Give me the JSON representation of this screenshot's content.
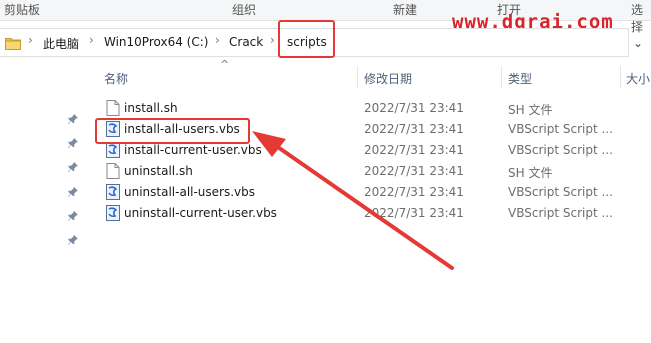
{
  "ribbon": {
    "groups": [
      "剪贴板",
      "组织",
      "新建",
      "打开",
      "选择"
    ]
  },
  "watermark": "www.dgrai.com",
  "address": {
    "crumbs": [
      "此电脑",
      "Win10Prox64 (C:)",
      "Crack",
      "scripts"
    ]
  },
  "columns": {
    "name": "名称",
    "date": "修改日期",
    "type": "类型",
    "size": "大小"
  },
  "files": [
    {
      "name": "install.sh",
      "date": "2022/7/31 23:41",
      "type": "SH 文件",
      "icon": "sh-file-icon"
    },
    {
      "name": "install-all-users.vbs",
      "date": "2022/7/31 23:41",
      "type": "VBScript Script ...",
      "icon": "vbs-file-icon"
    },
    {
      "name": "install-current-user.vbs",
      "date": "2022/7/31 23:41",
      "type": "VBScript Script ...",
      "icon": "vbs-file-icon"
    },
    {
      "name": "uninstall.sh",
      "date": "2022/7/31 23:41",
      "type": "SH 文件",
      "icon": "sh-file-icon"
    },
    {
      "name": "uninstall-all-users.vbs",
      "date": "2022/7/31 23:41",
      "type": "VBScript Script ...",
      "icon": "vbs-file-icon"
    },
    {
      "name": "uninstall-current-user.vbs",
      "date": "2022/7/31 23:41",
      "type": "VBScript Script ...",
      "icon": "vbs-file-icon"
    }
  ],
  "colors": {
    "annotation": "#e53935",
    "watermark": "#d8242c"
  }
}
